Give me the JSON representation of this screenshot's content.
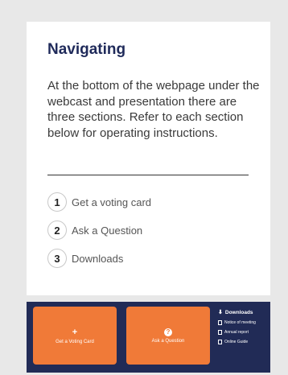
{
  "card": {
    "title": "Navigating",
    "intro": "At the bottom of the webpage under the webcast and presentation there are three sections. Refer to each section below for operating instructions.",
    "items": [
      {
        "num": "1",
        "label": "Get a voting card"
      },
      {
        "num": "2",
        "label": "Ask a Question"
      },
      {
        "num": "3",
        "label": "Downloads"
      }
    ]
  },
  "footer": {
    "voting_button": "Get a Voting Card",
    "question_button": "Ask a Question",
    "downloads": {
      "heading": "Downloads",
      "links": [
        "Notice of meeting",
        "Annual report",
        "Online Guide"
      ]
    }
  },
  "colors": {
    "title": "#1f2a5a",
    "footer_bg": "#212b56",
    "button_orange": "#f07a38"
  }
}
